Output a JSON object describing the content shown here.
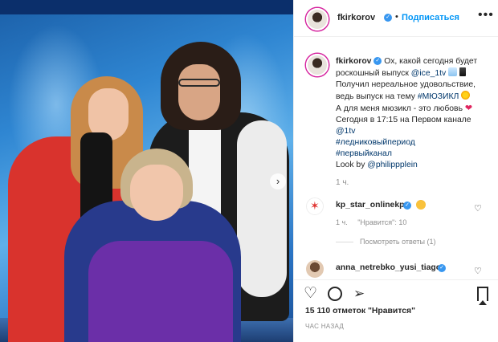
{
  "header": {
    "username": "fkirkorov",
    "separator": "•",
    "follow_label": "Подписаться",
    "more_icon": "more-horizontal-icon"
  },
  "caption": {
    "username": "fkirkorov",
    "line1": "Ох, какой сегодня будет",
    "line2a": "роскошный выпуск",
    "mention_ice": "@ice_1tv",
    "line3": "Получил нереальное удовольствие,",
    "line4a": "ведь выпуск на тему",
    "hashtag_musical": "#МЮЗИКЛ",
    "line5": "А для меня мюзикл - это любовь",
    "line6": "Сегодня в 17:15 на Первом канале",
    "mention_1tv": "@1tv",
    "hashtag_1": "#ледниковыйпериод",
    "hashtag_2": "#первыйканал",
    "look_by": "Look by",
    "mention_plein": "@philippplein",
    "time": "1 ч."
  },
  "comments": [
    {
      "username": "kp_star_onlinekp",
      "time": "1 ч.",
      "likes": "\"Нравится\": 10",
      "view_replies": "Посмотреть ответы (1)"
    },
    {
      "username": "anna_netrebko_yusi_tiago"
    }
  ],
  "actions": {
    "likes_count": "15 110 отметок \"Нравится\"",
    "posted_ago": "ЧАС НАЗАД"
  },
  "colors": {
    "link": "#00376b",
    "follow": "#0095f6",
    "verified": "#3897f0"
  }
}
